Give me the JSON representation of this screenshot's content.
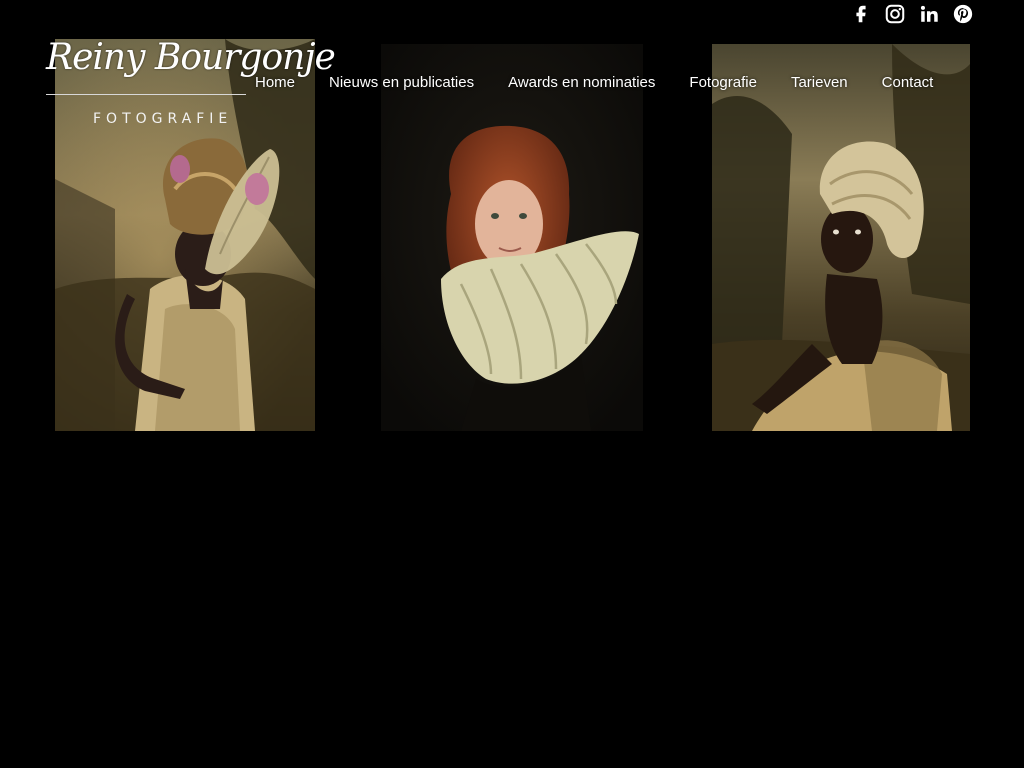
{
  "brand": {
    "script_name": "Reiny Bourgonje",
    "subtitle": "FOTOGRAFIE"
  },
  "nav": {
    "items": [
      {
        "label": "Home"
      },
      {
        "label": "Nieuws en publicaties"
      },
      {
        "label": "Awards en nominaties"
      },
      {
        "label": "Fotografie"
      },
      {
        "label": "Tarieven"
      },
      {
        "label": "Contact"
      }
    ]
  },
  "social": [
    "facebook-icon",
    "instagram-icon",
    "linkedin-icon",
    "pinterest-icon"
  ],
  "photos": [
    {
      "subject": "girl with headwrap and woven hat, landscape background"
    },
    {
      "subject": "red-haired girl with pleated ruff collar, dark background"
    },
    {
      "subject": "seated girl with headwrap, landscape background"
    }
  ],
  "colors": {
    "background": "#000000",
    "text": "#ffffff"
  }
}
